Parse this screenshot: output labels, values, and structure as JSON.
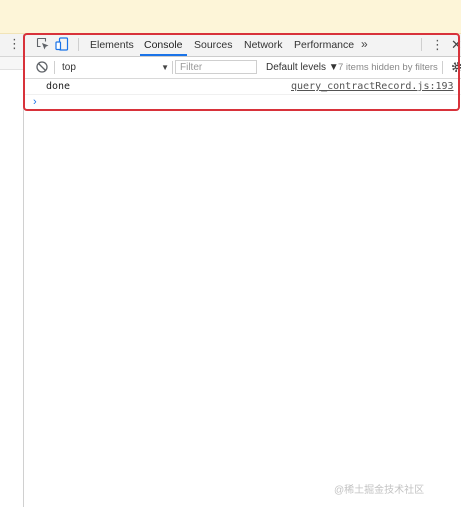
{
  "toolbar": {
    "tabs": [
      {
        "label": "Elements"
      },
      {
        "label": "Console"
      },
      {
        "label": "Sources"
      },
      {
        "label": "Network"
      },
      {
        "label": "Performance"
      }
    ],
    "active_tab": "Console",
    "more_tabs_glyph": "»",
    "menu_glyph": "⋮",
    "close_glyph": "✕",
    "icons": [
      "inspect-element-icon",
      "device-toolbar-icon"
    ]
  },
  "console_bar": {
    "context_value": "top",
    "filter_placeholder": "Filter",
    "levels_label": "Default levels ▼",
    "hidden_info": "7 items hidden by filters",
    "icons": [
      "clear-console-icon",
      "settings-gear-icon"
    ]
  },
  "messages": [
    {
      "text": "done",
      "source": "query_contractRecord.js:193"
    }
  ],
  "prompt_glyph": "›",
  "left_panel": {
    "menu_glyph": "⋮"
  },
  "watermark": "@稀土掘金技术社区",
  "colors": {
    "highlight": "#d8323a",
    "accent": "#1a73e8",
    "banner": "#fdf5d8"
  }
}
